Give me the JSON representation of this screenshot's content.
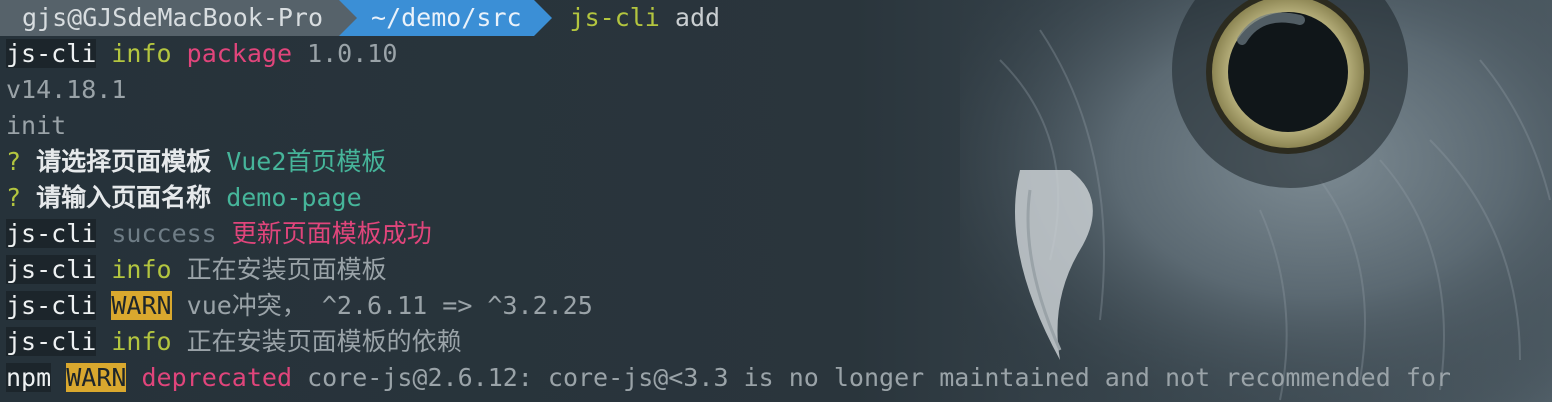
{
  "prompt": {
    "user_host": "gjs@GJSdeMacBook-Pro",
    "path": "~/demo/src",
    "command": "js-cli",
    "command_arg": "add"
  },
  "lines": [
    {
      "prefix": "js-cli",
      "level": "info",
      "key": "package",
      "text": "1.0.10"
    },
    {
      "text": "v14.18.1"
    },
    {
      "text": "init"
    },
    {
      "q": "?",
      "label": "请选择页面模板",
      "answer": "Vue2首页模板"
    },
    {
      "q": "?",
      "label": "请输入页面名称",
      "answer": "demo-page"
    },
    {
      "prefix": "js-cli",
      "level": "success",
      "text": "更新页面模板成功"
    },
    {
      "prefix": "js-cli",
      "level": "info",
      "text": "正在安装页面模板"
    },
    {
      "prefix": "js-cli",
      "level": "WARN",
      "text": "vue冲突， ^2.6.11 => ^3.2.25"
    },
    {
      "prefix": "js-cli",
      "level": "info",
      "text": "正在安装页面模板的依赖"
    },
    {
      "prefix": "npm",
      "level": "WARN",
      "key": "deprecated",
      "text": "core-js@2.6.12: core-js@<3.3 is no longer maintained and not recommended for"
    }
  ],
  "colors": {
    "background": "#2a343b",
    "info": "#b3c53f",
    "pink": "#e0457b",
    "teal": "#46b59a",
    "warn_bg": "#d9a82e",
    "path_segment": "#3b8fd6",
    "user_segment": "#56626a"
  },
  "background_art": "owl-icon"
}
